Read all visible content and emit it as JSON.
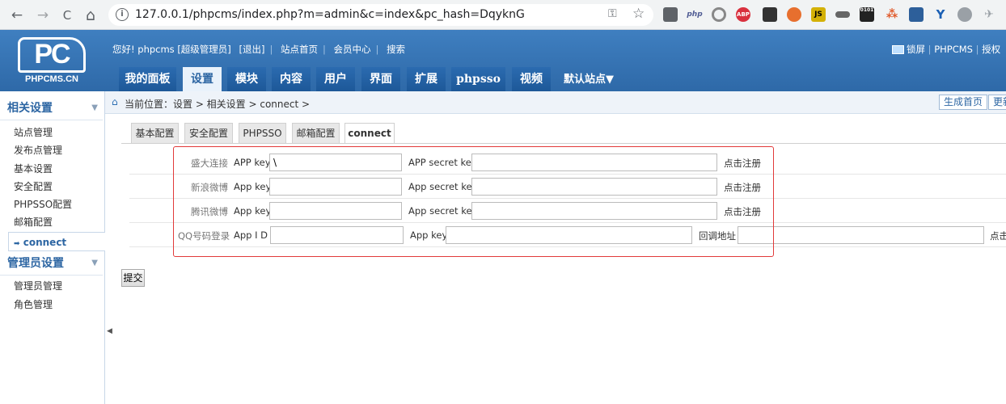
{
  "browser": {
    "url": "127.0.0.1/phpcms/index.php?m=admin&c=index&pc_hash=DqyknG",
    "nav": {
      "back": "←",
      "forward": "→",
      "reload": "C",
      "home": "⌂"
    },
    "extensions": [
      {
        "name": "php-ext",
        "label": "php",
        "color": "#4f5b93"
      },
      {
        "name": "abp-ext",
        "label": "ABP",
        "color": "#d9303e"
      },
      {
        "name": "js-ext",
        "label": "JS",
        "color": "#d4b106"
      },
      {
        "name": "binary-ext",
        "label": "0101",
        "color": "#222222"
      }
    ]
  },
  "header": {
    "logo_text": "PC",
    "logo_site": "PHPCMS.CN",
    "top_links": [
      "您好! phpcms [超级管理员]",
      "[退出]",
      "站点首页",
      "会员中心",
      "搜索"
    ],
    "right_links": {
      "lock": "锁屏",
      "product": "PHPCMS",
      "license": "授权"
    },
    "main_tabs": [
      "我的面板",
      "设置",
      "模块",
      "内容",
      "用户",
      "界面",
      "扩展",
      "phpsso",
      "视频"
    ],
    "active_tab": 1,
    "site_menu": "默认站点▼"
  },
  "sidebar": {
    "section1": "相关设置",
    "items1": [
      "站点管理",
      "发布点管理",
      "基本设置",
      "安全配置",
      "PHPSSO配置",
      "邮箱配置"
    ],
    "active_item": "connect",
    "section2": "管理员设置",
    "items2": [
      "管理员管理",
      "角色管理"
    ]
  },
  "breadcrumb": {
    "text": "当前位置：设置 > 相关设置 > connect >",
    "buttons": [
      "生成首页",
      "更新"
    ]
  },
  "sub_tabs": [
    "基本配置",
    "安全配置",
    "PHPSSO",
    "邮箱配置",
    "connect"
  ],
  "active_sub_tab": 4,
  "form": {
    "rows": [
      {
        "label": "盛大连接",
        "f1": "APP key",
        "v1": "\\",
        "f2": "APP secret key",
        "v2": "",
        "link": "点击注册"
      },
      {
        "label": "新浪微博",
        "f1": "App key",
        "v1": "",
        "f2": "App secret key",
        "v2": "",
        "link": "点击注册"
      },
      {
        "label": "腾讯微博",
        "f1": "App key",
        "v1": "",
        "f2": "App secret key",
        "v2": "",
        "link": "点击注册"
      },
      {
        "label": "QQ号码登录",
        "f1": "App I D",
        "v1": "",
        "f2": "App key",
        "v2": "",
        "f3": "回调地址",
        "v3": "",
        "link": "点击"
      }
    ],
    "submit": "提交"
  }
}
